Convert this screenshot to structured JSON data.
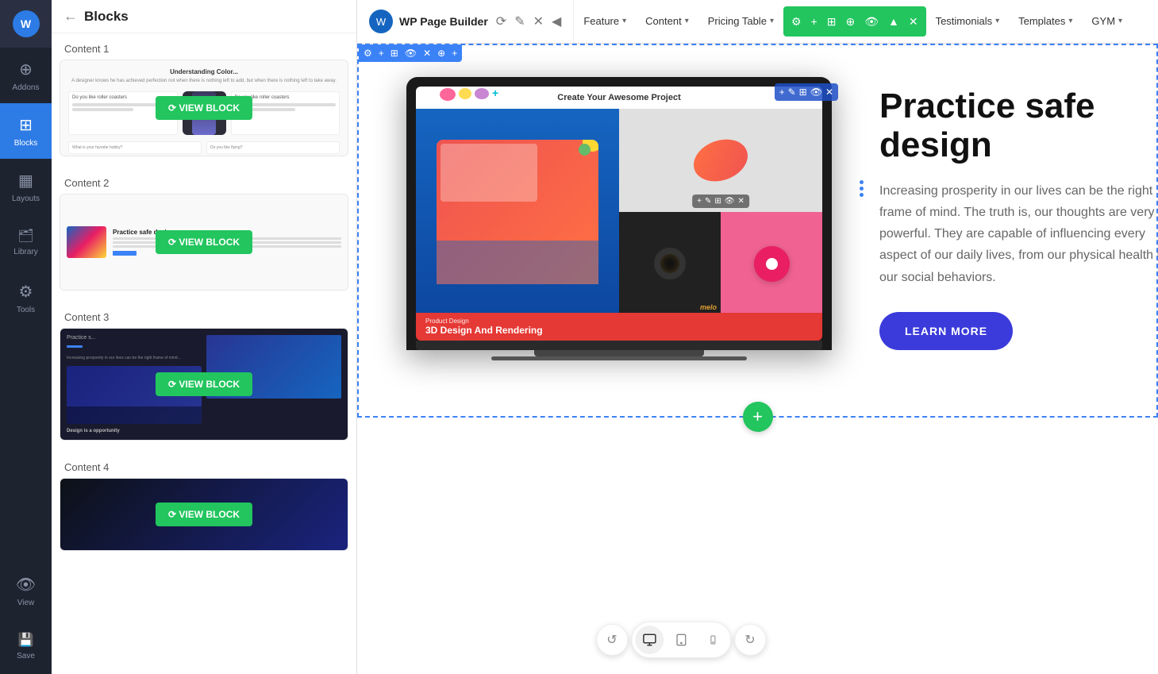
{
  "app": {
    "title": "WP Page Builder",
    "logo_char": "W"
  },
  "sidebar": {
    "items": [
      {
        "id": "addons",
        "label": "Addons",
        "icon": "➕"
      },
      {
        "id": "blocks",
        "label": "Blocks",
        "icon": "⊞",
        "active": true
      },
      {
        "id": "layouts",
        "label": "Layouts",
        "icon": "▦"
      },
      {
        "id": "library",
        "label": "Library",
        "icon": "📚"
      },
      {
        "id": "tools",
        "label": "Tools",
        "icon": "⚙"
      },
      {
        "id": "view",
        "label": "View",
        "icon": "👁"
      },
      {
        "id": "save",
        "label": "Save",
        "icon": "💾"
      }
    ]
  },
  "blocks_panel": {
    "title": "Blocks",
    "sections": [
      {
        "title": "Content 1",
        "view_block_label": "⟳ VIEW BLOCK"
      },
      {
        "title": "Content 2",
        "view_block_label": "⟳ VIEW BLOCK"
      },
      {
        "title": "Content 3",
        "view_block_label": "⟳ VIEW BLOCK"
      },
      {
        "title": "Content 4",
        "view_block_label": "⟳ VIEW BLOCK"
      }
    ]
  },
  "top_nav": {
    "items": [
      {
        "label": "Feature",
        "has_dropdown": true
      },
      {
        "label": "Content",
        "has_dropdown": true
      },
      {
        "label": "Pricing Table",
        "has_dropdown": true
      },
      {
        "label": "Testimonials",
        "has_dropdown": true
      },
      {
        "label": "Templates",
        "has_dropdown": true
      },
      {
        "label": "GYM",
        "has_dropdown": true
      }
    ],
    "toolbar_icons": [
      "⚙",
      "☁",
      "⊞",
      "⊕",
      "⌃",
      "↑",
      "✕"
    ]
  },
  "content": {
    "laptop_top_text": "Create Your Awesome Project",
    "product_label": "Product Design",
    "product_title": "3D Design And Rendering",
    "heading": "Practice safe design",
    "body": "Increasing prosperity in our lives can be the right frame of mind. The truth is, our thoughts are very powerful. They are capable of influencing every aspect of our daily lives, from our physical health to our social behaviors.",
    "learn_more": "LEARN MORE"
  },
  "bottom_toolbar": {
    "undo_icon": "↺",
    "desktop_icon": "🖥",
    "tablet_icon": "⊞",
    "mobile_icon": "📱",
    "redo_icon": "↻"
  },
  "add_block_btn": "+",
  "header_icons": [
    "⟳",
    "✎",
    "✕",
    "◀"
  ]
}
